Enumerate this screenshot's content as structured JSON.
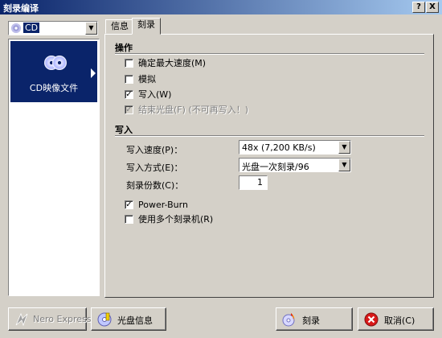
{
  "window": {
    "title": "刻录编译",
    "help_label": "?",
    "close_label": "X"
  },
  "drive": {
    "selected": "CD"
  },
  "left_panel": {
    "item_label": "CD映像文件"
  },
  "tabs": [
    {
      "label": "信息"
    },
    {
      "label": "刻录"
    }
  ],
  "operations": {
    "title": "操作",
    "items": [
      {
        "label": "确定最大速度(M)",
        "checked": false,
        "enabled": true
      },
      {
        "label": "模拟",
        "checked": false,
        "enabled": true
      },
      {
        "label": "写入(W)",
        "checked": true,
        "enabled": true
      },
      {
        "label": "结束光盘(F) (不可再写入！)",
        "checked": true,
        "enabled": false
      }
    ]
  },
  "write": {
    "title": "写入",
    "speed_label": "写入速度(P)：",
    "speed_value": "48x (7,200 KB/s)",
    "method_label": "写入方式(E)：",
    "method_value": "光盘一次刻录/96",
    "copies_label": "刻录份数(C)：",
    "copies_value": "1",
    "powerburn_label": "Power-Burn",
    "multi_recorder_label": "使用多个刻录机(R)"
  },
  "buttons": {
    "nero_express": "Nero Express(X)",
    "disc_info": "光盘信息",
    "burn": "刻录",
    "cancel": "取消(C)"
  }
}
